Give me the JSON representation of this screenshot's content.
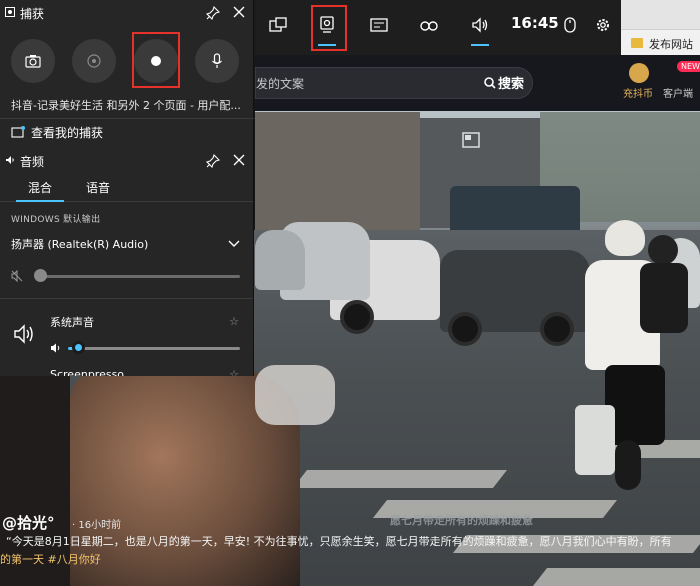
{
  "gamebar": {
    "time": "16:45",
    "icons": [
      "widget-menu-icon",
      "capture-icon",
      "performance-icon",
      "xbox-social-icon",
      "audio-icon",
      "mouse-icon",
      "settings-icon"
    ],
    "accent": "#4cc2ff",
    "highlight": "#e5322d"
  },
  "capture": {
    "title": "捕获",
    "buttons": [
      "screenshot",
      "record-last",
      "start-recording",
      "microphone"
    ],
    "source_text": "抖音-记录美好生活 和另外 2 个页面 - 用户配...",
    "link": "查看我的捕获"
  },
  "audio": {
    "title": "音频",
    "tabs": [
      "混合",
      "语音"
    ],
    "output_label": "WINDOWS 默认输出",
    "device": "扬声器 (Realtek(R) Audio)",
    "apps": [
      {
        "name": "系统声音"
      },
      {
        "name": "Screenpresso"
      }
    ]
  },
  "page": {
    "search_text": "发的文案",
    "search_button": "搜索",
    "coin_label": "充抖币",
    "client_label": "客户端",
    "new_badge": "NEW",
    "bookmark": "发布网站"
  },
  "video": {
    "author": "@拾光°",
    "time_ago": "· 16小时前",
    "description": "“今天是8月1日星期二，也是八月的第一天，早安! 不为往事忧，只愿余生笑，愿七月带走所有的烦躁和疲惫，愿八月我们心中有盼，所有",
    "tags": "的第一天 #八月你好",
    "subtitle": "愿七月带走所有的烦躁和疲惫"
  }
}
